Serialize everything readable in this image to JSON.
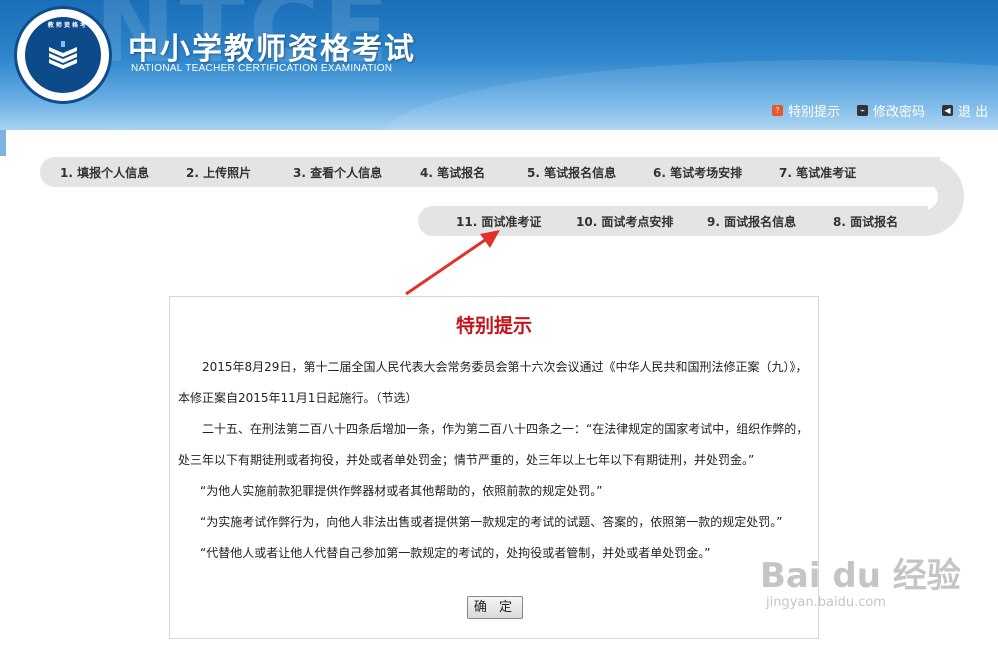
{
  "header": {
    "bg_text": "NTCE",
    "logo_ring_text": "教 师 资 格 考 试",
    "title": "中小学教师资格考试",
    "subtitle": "NATIONAL TEACHER CERTIFICATION EXAMINATION",
    "links": [
      {
        "label": "特别提示",
        "icon": "notice-icon",
        "icon_glyph": "?",
        "color": "#e8562a"
      },
      {
        "label": "修改密码",
        "icon": "key-icon",
        "icon_glyph": "⌁",
        "color": "#333333"
      },
      {
        "label": "退 出",
        "icon": "exit-icon",
        "icon_glyph": "◀",
        "color": "#333333"
      }
    ]
  },
  "steps_row1": [
    "1. 填报个人信息",
    "2. 上传照片",
    "3. 查看个人信息",
    "4. 笔试报名",
    "5. 笔试报名信息",
    "6. 笔试考场安排",
    "7. 笔试准考证"
  ],
  "steps_row2": [
    "11. 面试准考证",
    "10. 面试考点安排",
    "9. 面试报名信息",
    "8. 面试报名"
  ],
  "notice": {
    "title": "特别提示",
    "p1": "2015年8月29日，第十二届全国人民代表大会常务委员会第十六次会议通过《中华人民共和国刑法修正案（九）》，本修正案自2015年11月1日起施行。（节选）",
    "p2": "二十五、在刑法第二百八十四条后增加一条，作为第二百八十四条之一：“在法律规定的国家考试中，组织作弊的，处三年以下有期徒刑或者拘役，并处或者单处罚金；情节严重的，处三年以上七年以下有期徒刑，并处罚金。”",
    "p3": "“为他人实施前款犯罪提供作弊器材或者其他帮助的，依照前款的规定处罚。”",
    "p4": "“为实施考试作弊行为，向他人非法出售或者提供第一款规定的考试的试题、答案的，依照第一款的规定处罚。”",
    "p5": "“代替他人或者让他人代替自己参加第一款规定的考试的，处拘役或者管制，并处或者单处罚金。”",
    "ok_button": "确 定"
  },
  "watermark": {
    "line1": "Bai du 经验",
    "line2": "jingyan.baidu.com"
  },
  "colors": {
    "header_blue": "#2e86cc",
    "notice_title": "#c1161c",
    "nav_bg": "#e4e4e4",
    "arrow": "#e0322a"
  }
}
